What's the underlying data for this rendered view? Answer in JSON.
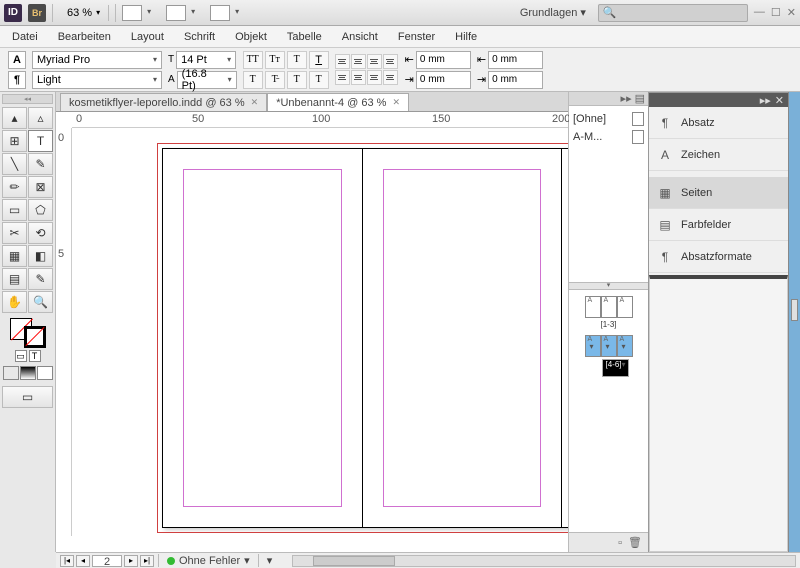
{
  "top": {
    "zoom": "63 %",
    "workspace": "Grundlagen"
  },
  "menu": [
    "Datei",
    "Bearbeiten",
    "Layout",
    "Schrift",
    "Objekt",
    "Tabelle",
    "Ansicht",
    "Fenster",
    "Hilfe"
  ],
  "ctrl": {
    "font": "Myriad Pro",
    "style": "Light",
    "size": "14 Pt",
    "leading": "(16.8 Pt)",
    "indent": "0 mm"
  },
  "tabs": [
    {
      "label": "kosmetikflyer-leporello.indd @ 63 %",
      "active": false
    },
    {
      "label": "*Unbenannt-4 @ 63 %",
      "active": true
    }
  ],
  "ruler": {
    "marks": [
      "0",
      "50",
      "100",
      "150",
      "200"
    ],
    "vmarks": [
      "0",
      "5"
    ]
  },
  "pages": {
    "masters": [
      {
        "name": "[Ohne]"
      },
      {
        "name": "A-M..."
      }
    ],
    "spreads": [
      {
        "label": "[1-3]",
        "selected": false
      },
      {
        "label": "[4-6]",
        "selected": true
      }
    ]
  },
  "panels": [
    {
      "label": "Absatz",
      "icon": "¶"
    },
    {
      "label": "Zeichen",
      "icon": "A"
    },
    {
      "label": "Seiten",
      "icon": "▦",
      "active": true
    },
    {
      "label": "Farbfelder",
      "icon": "▤"
    },
    {
      "label": "Absatzformate",
      "icon": "¶"
    }
  ],
  "status": {
    "page": "2",
    "preflight": "Ohne Fehler"
  }
}
